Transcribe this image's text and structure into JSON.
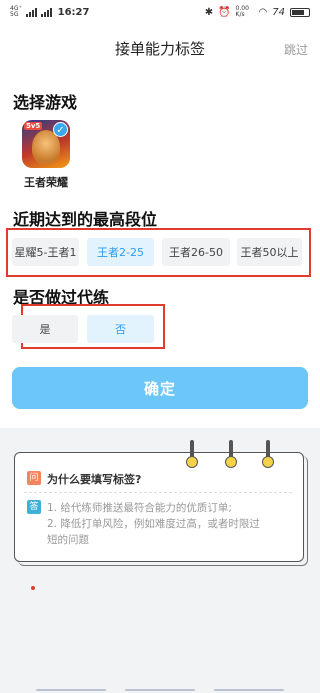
{
  "status_bar": {
    "network_left_top": "4G⁺",
    "network_left_bottom": "5G",
    "time": "16:27",
    "speed": "0.00 K/s",
    "battery": "74"
  },
  "header": {
    "title": "接单能力标签",
    "skip": "跳过"
  },
  "section_game": {
    "title": "选择游戏",
    "game_name": "王者荣耀",
    "game_badge": "5v5"
  },
  "section_rank": {
    "title": "近期达到的最高段位",
    "options": [
      "星耀5-王者1",
      "王者2-25",
      "王者26-50",
      "王者50以上"
    ],
    "selected": "王者2-25"
  },
  "section_boost": {
    "title": "是否做过代练",
    "options": [
      "是",
      "否"
    ],
    "selected": "否"
  },
  "confirm_button": "确定",
  "info_card": {
    "question_badge": "问",
    "question": "为什么要填写标签?",
    "answer_badge": "答",
    "answer_lines": [
      "1. 给代练师推送最符合能力的优质订单;",
      "2. 降低打单风险，例如难度过高，或者时限过",
      "短的问题"
    ]
  },
  "colors": {
    "accent": "#2e9cf0",
    "confirm_bg": "#6cc6f7",
    "highlight_box": "#e23b2e"
  }
}
